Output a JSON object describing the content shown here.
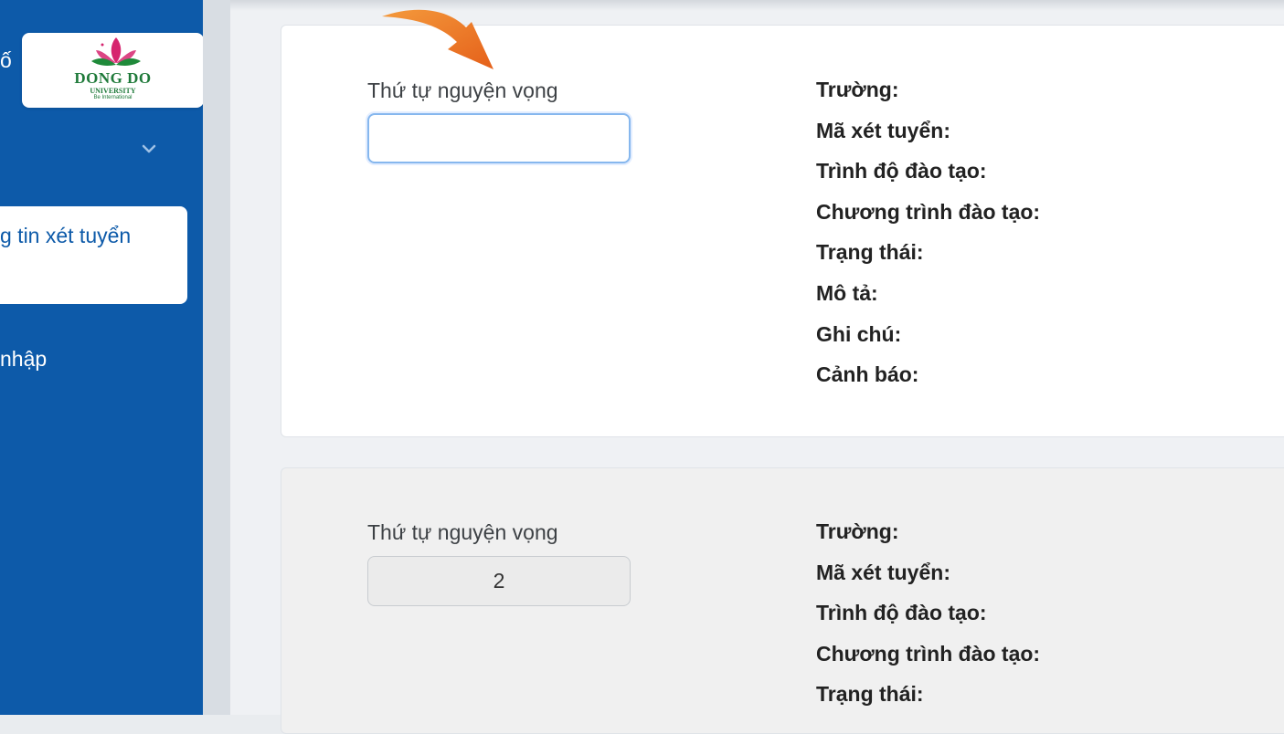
{
  "sidebar": {
    "partial_top_text": "ố",
    "logo": {
      "name": "DONG DO",
      "sub": "UNIVERSITY",
      "tagline": "Be International"
    },
    "active_item_label": "g tin xét tuyển",
    "login_partial_label": "nhập"
  },
  "cards": [
    {
      "order_label": "Thứ tự nguyện vọng",
      "order_value": "",
      "fields": [
        "Trường:",
        "Mã xét tuyển:",
        "Trình độ đào tạo:",
        "Chương trình đào tạo:",
        "Trạng thái:",
        "Mô tả:",
        "Ghi chú:",
        "Cảnh báo:"
      ]
    },
    {
      "order_label": "Thứ tự nguyện vọng",
      "order_value": "2",
      "fields": [
        "Trường:",
        "Mã xét tuyển:",
        "Trình độ đào tạo:",
        "Chương trình đào tạo:",
        "Trạng thái:"
      ]
    }
  ],
  "colors": {
    "sidebar": "#0d5aa9",
    "accent_arrow": "#f07a1a",
    "logo_green": "#1f7a3a",
    "logo_pink": "#d6246e"
  }
}
